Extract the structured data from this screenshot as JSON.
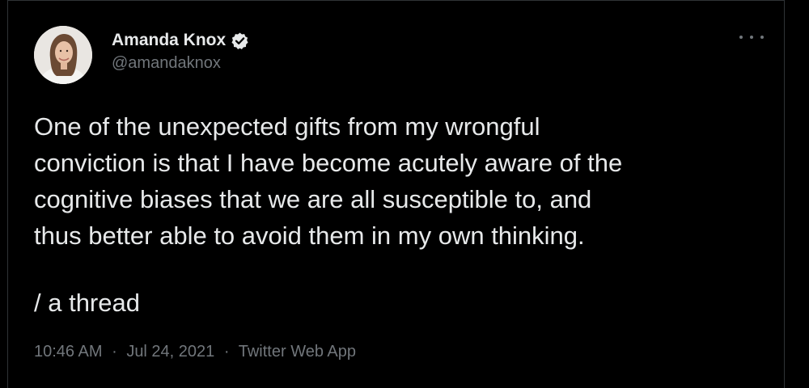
{
  "tweet": {
    "author": {
      "display_name": "Amanda Knox",
      "handle": "@amandaknox",
      "verified": true,
      "avatar_icon": "profile-photo"
    },
    "text_lines": [
      "One of the unexpected gifts from my wrongful",
      "conviction is that I have become acutely aware of the",
      "cognitive biases that we are all susceptible to, and",
      "thus better able to avoid them in my own thinking."
    ],
    "thread_marker": "/ a thread",
    "time": "10:46 AM",
    "date": "Jul 24, 2021",
    "source": "Twitter Web App",
    "separator": "·"
  },
  "colors": {
    "background": "#000000",
    "text_primary": "#e7e9ea",
    "text_secondary": "#71767b",
    "verified_badge": "#e7e9ea",
    "border": "#2f3336"
  },
  "icons": {
    "verified": "verified-badge-icon",
    "more": "more-options-icon"
  }
}
